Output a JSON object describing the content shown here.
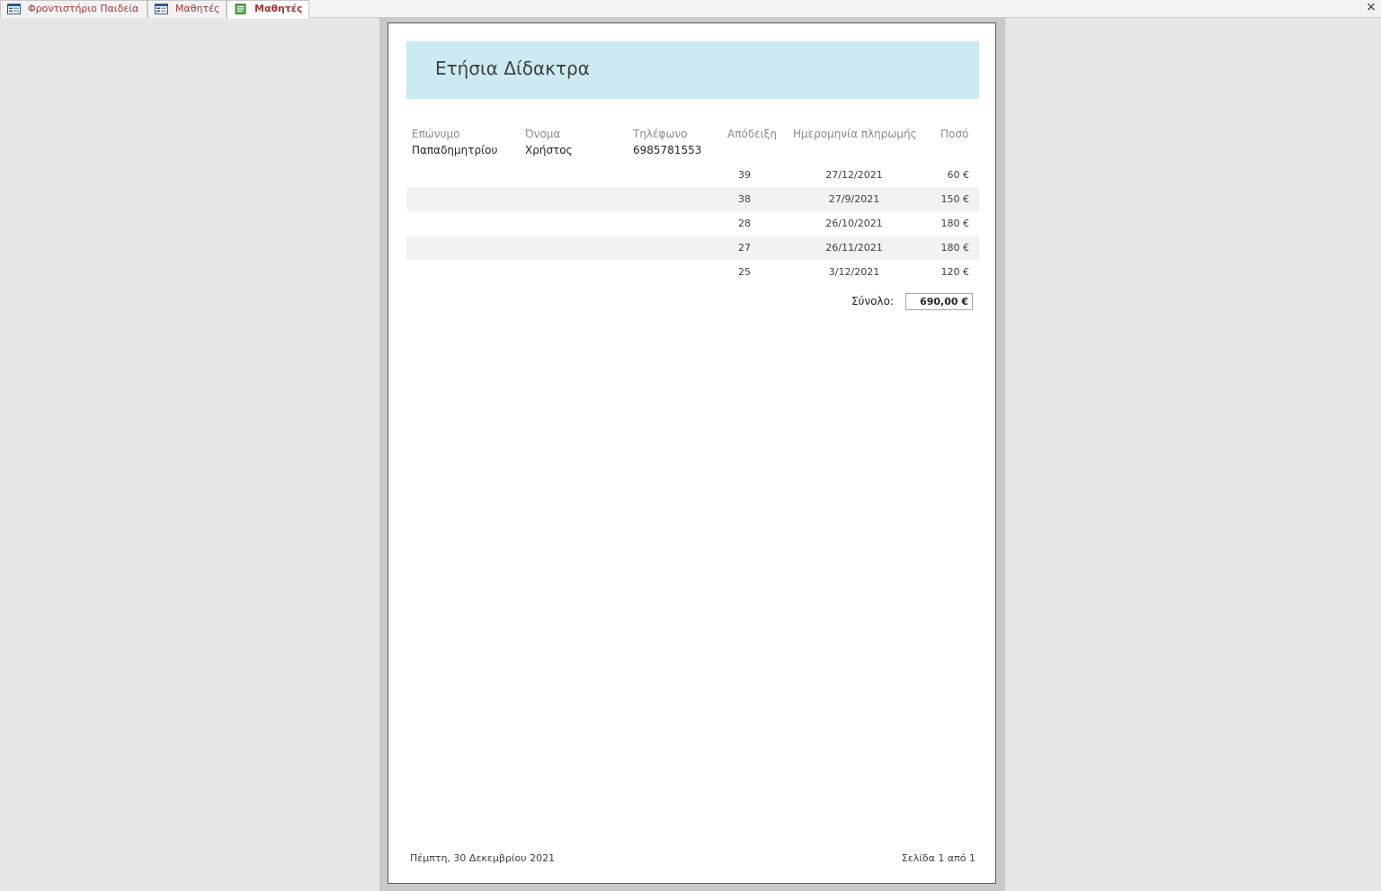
{
  "tabs": [
    {
      "label": "Φροντιστήριο Παιδεία",
      "icon": "form-icon",
      "active": false
    },
    {
      "label": "Μαθητές",
      "icon": "form-icon",
      "active": false
    },
    {
      "label": "Μαθητές",
      "icon": "report-icon",
      "active": true
    }
  ],
  "close_label": "×",
  "report": {
    "title": "Ετήσια Δίδακτρα",
    "headers": {
      "surname": "Επώνυμο",
      "name": "Όνομα",
      "phone": "Τηλέφωνο",
      "receipt": "Απόδειξη",
      "date": "Ημερομηνία πληρωμής",
      "amount": "Ποσό"
    },
    "student": {
      "surname": "Παπαδημητρίου",
      "name": "Χρήστος",
      "phone": "6985781553"
    },
    "payments": [
      {
        "receipt": "39",
        "date": "27/12/2021",
        "amount": "60 €"
      },
      {
        "receipt": "38",
        "date": "27/9/2021",
        "amount": "150 €"
      },
      {
        "receipt": "28",
        "date": "26/10/2021",
        "amount": "180 €"
      },
      {
        "receipt": "27",
        "date": "26/11/2021",
        "amount": "180 €"
      },
      {
        "receipt": "25",
        "date": "3/12/2021",
        "amount": "120 €"
      }
    ],
    "total_label": "Σύνολο:",
    "total_value": "690,00 €",
    "footer_date": "Πέμπτη, 30 Δεκεμβρίου 2021",
    "footer_page": "Σελίδα 1 από 1"
  },
  "colors": {
    "tab_text": "#a4373a",
    "title_band": "#cceaf1",
    "alt_row": "#f2f2f2",
    "form_icon_blue": "#2f5597",
    "report_icon_green": "#3a8a3a"
  }
}
